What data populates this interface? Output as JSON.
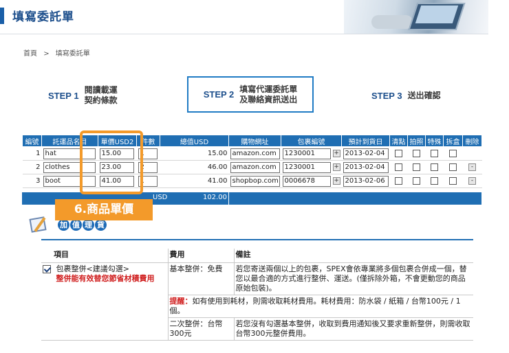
{
  "header": {
    "title": "填寫委託單"
  },
  "breadcrumb": [
    "首頁",
    ">",
    "填寫委託單"
  ],
  "steps": [
    {
      "num": "STEP 1",
      "line1": "閱讀載運",
      "line2": "契約條款"
    },
    {
      "num": "STEP 2",
      "line1": "填寫代運委託單",
      "line2": "及聯絡資訊送出"
    },
    {
      "num": "STEP 3",
      "line1": "送出確認",
      "line2": ""
    }
  ],
  "table": {
    "headers": [
      "編號",
      "託運品名目",
      "單價USD2",
      "件數",
      "總值USD",
      "購物網址",
      "包裹編號",
      "預計到貨日",
      "清點",
      "拍照",
      "特殊",
      "拆盒",
      "刪除"
    ],
    "rows": [
      {
        "no": "1",
        "name": "hat",
        "price": "15.00",
        "qty": "1",
        "total": "15.00",
        "url": "amazon.com",
        "pkg": "1230001",
        "date": "2013-02-04",
        "delete": false
      },
      {
        "no": "2",
        "name": "clothes",
        "price": "23.00",
        "qty": "2",
        "total": "46.00",
        "url": "amazon.com",
        "pkg": "1230001",
        "date": "2013-02-04",
        "delete": true
      },
      {
        "no": "3",
        "name": "boot",
        "price": "41.00",
        "qty": "1",
        "total": "41.00",
        "url": "shopbop.com",
        "pkg": "0006678",
        "date": "2013-02-06",
        "delete": true
      }
    ],
    "total_currency": "USD",
    "total_value": "102.00",
    "plus_symbol": "+",
    "minus_symbol": "-"
  },
  "annotation": {
    "label": "6.商品單價"
  },
  "value_added": {
    "chars": [
      "加",
      "值",
      "理",
      "貨"
    ]
  },
  "services": {
    "headers": [
      "項目",
      "費用",
      "備註"
    ],
    "row1": {
      "item": "包裹整併<建議勾選>",
      "item_note": "整併能有效替您節省材積費用",
      "fee": "基本整併：免費",
      "note": "若您寄送兩個以上的包裹，SPEX會依專業將多個包裹合併成一個，替您以最合適的方式進行整併、運送。(僅拆除外箱，不會更動您的商品原始包裝)。"
    },
    "row2": {
      "warn_label": "提醒：",
      "warn_text": "如有使用到耗材，則需收取耗材費用。耗材費用：防水袋 / 紙箱 / 台幣100元 / 1個。"
    },
    "row3": {
      "fee": "二次整併：台幣300元",
      "note": "若您沒有勾選基本整併，收取到費用通知後又要求重新整併，則需收取台幣300元整併費用。"
    }
  }
}
